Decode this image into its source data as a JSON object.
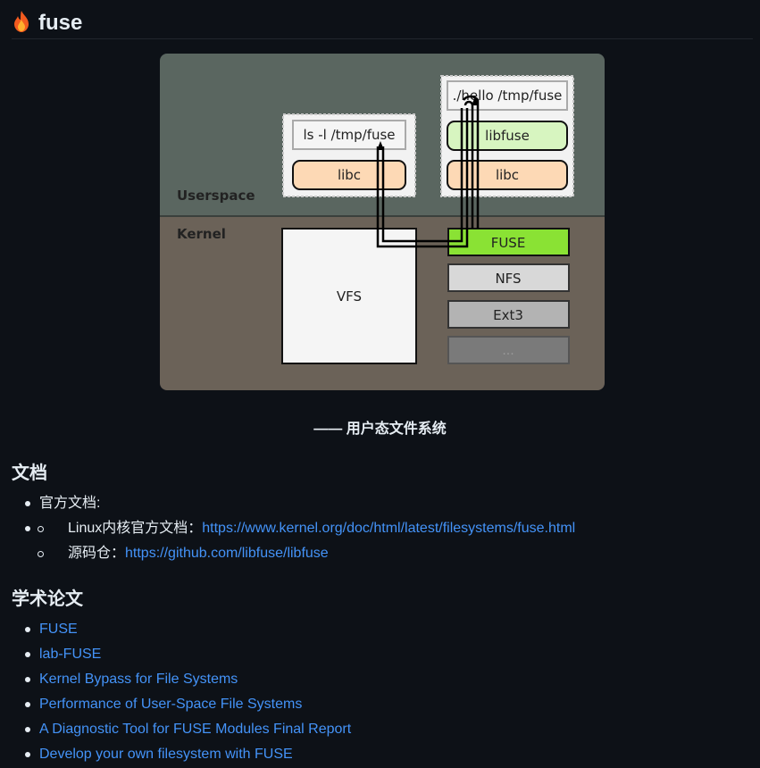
{
  "header": {
    "title": "fuse"
  },
  "diagram": {
    "userspace_label": "Userspace",
    "kernel_label": "Kernel",
    "ls_cmd": "ls -l /tmp/fuse",
    "libc_left": "libc",
    "hello_cmd": "./hello /tmp/fuse",
    "libfuse": "libfuse",
    "libc_right": "libc",
    "vfs": "VFS",
    "fuse": "FUSE",
    "nfs": "NFS",
    "ext3": "Ext3",
    "more": "..."
  },
  "caption": "—— 用户态文件系统",
  "docs": {
    "heading": "文档",
    "item_label": "官方文档:",
    "kernel_doc_label": "Linux内核官方文档：",
    "kernel_doc_link": "https://www.kernel.org/doc/html/latest/filesystems/fuse.html",
    "repo_label": "源码仓：",
    "repo_link": "https://github.com/libfuse/libfuse"
  },
  "papers": {
    "heading": "学术论文",
    "items": [
      "FUSE",
      "lab-FUSE",
      "Kernel Bypass for File Systems",
      "Performance of User-Space File Systems",
      "A Diagnostic Tool for FUSE Modules Final Report",
      "Develop your own filesystem with FUSE"
    ]
  },
  "colors": {
    "background": "#0d1117",
    "link": "#4493f8",
    "userspace_bg": "#5a6660",
    "kernel_bg": "#6b6258",
    "fuse_green": "#8ae234",
    "libfuse_green": "#d7f5c0",
    "libc_orange": "#fdd9b5"
  }
}
